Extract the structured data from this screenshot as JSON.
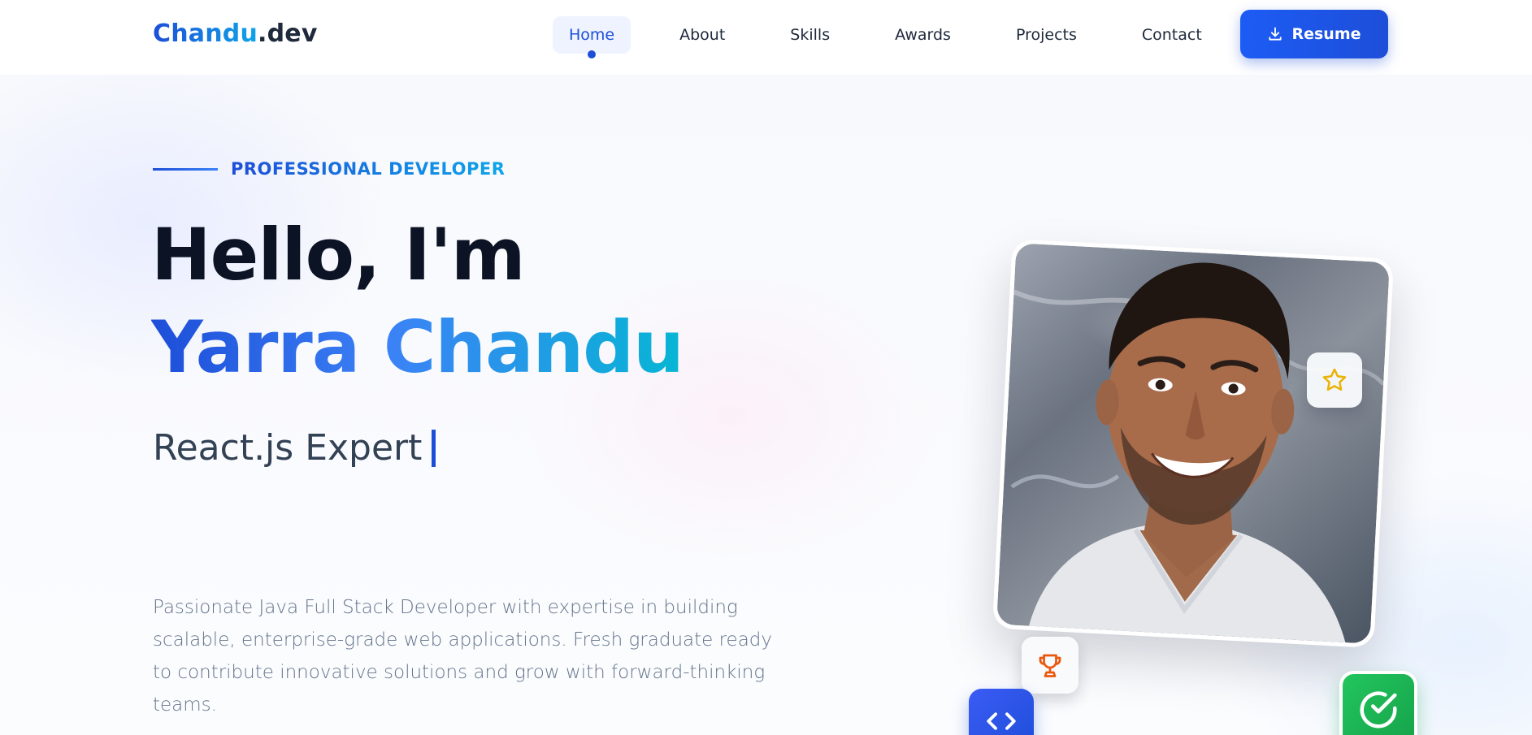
{
  "logo": {
    "brand": "Chandu",
    "tld": ".dev"
  },
  "nav": {
    "items": [
      {
        "label": "Home",
        "active": true
      },
      {
        "label": "About",
        "active": false
      },
      {
        "label": "Skills",
        "active": false
      },
      {
        "label": "Awards",
        "active": false
      },
      {
        "label": "Projects",
        "active": false
      },
      {
        "label": "Contact",
        "active": false
      }
    ],
    "resume_label": "Resume",
    "resume_icon": "download-icon"
  },
  "hero": {
    "tagline": "PROFESSIONAL DEVELOPER",
    "greeting": "Hello, I'm",
    "name": "Yarra Chandu",
    "role": "React.js Expert",
    "description": "Passionate Java Full Stack Developer with expertise in building scalable, enterprise-grade web applications. Fresh graduate ready to contribute innovative solutions and grow with forward-thinking teams."
  },
  "badges": {
    "star_icon": "star-icon",
    "trophy_icon": "trophy-icon",
    "code_icon": "code-icon",
    "check_icon": "check-circle-icon"
  },
  "colors": {
    "accent": "#1d4ed8",
    "accent_light": "#0ea5e9",
    "star": "#eab308",
    "trophy": "#ea580c",
    "success": "#16a34a"
  }
}
